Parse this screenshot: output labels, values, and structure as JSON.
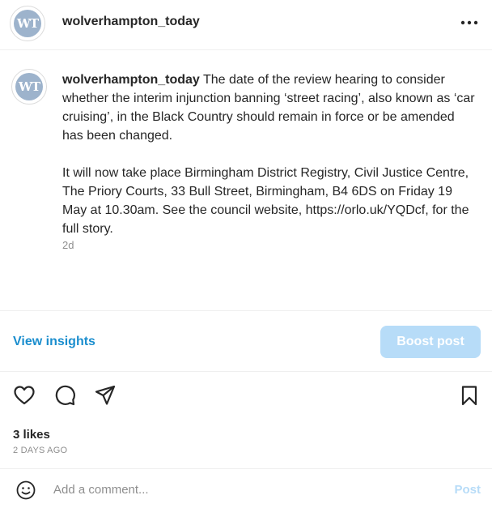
{
  "post": {
    "username": "wolverhampton_today",
    "avatar_text": "WT",
    "avatar_color": "#9db3cc"
  },
  "caption": {
    "username": "wolverhampton_today",
    "paragraph1": "The date of the review hearing to consider whether the interim injunction banning ‘street racing’, also known as ‘car cruising’, in the Black Country should remain in force or be amended has been changed.",
    "paragraph2": "It will now take place Birmingham District Registry, Civil Justice Centre, The Priory Courts, 33 Bull Street, Birmingham, B4 6DS on Friday 19 May at 10.30am. See the council website, https://orlo.uk/YQDcf, for the full story.",
    "time_ago": "2d"
  },
  "insights": {
    "view_label": "View insights",
    "boost_label": "Boost post",
    "link_color": "#1b8ece",
    "boost_color": "#b7dcf8"
  },
  "actions": {
    "icons": [
      "heart-icon",
      "comment-icon",
      "share-icon",
      "bookmark-icon"
    ]
  },
  "stats": {
    "likes": "3 likes",
    "timestamp": "2 DAYS AGO"
  },
  "comment": {
    "placeholder": "Add a comment...",
    "post_label": "Post"
  }
}
